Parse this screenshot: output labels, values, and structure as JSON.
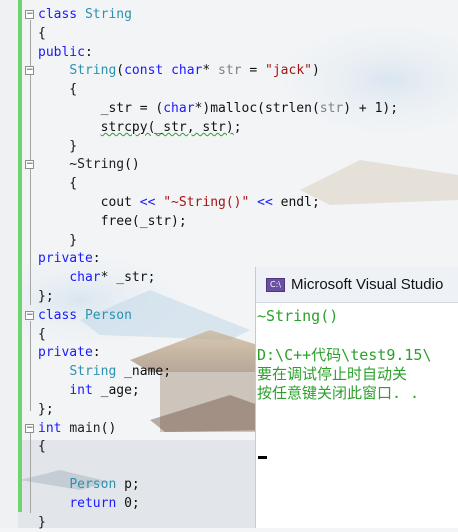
{
  "editor": {
    "lines": [
      {
        "fold": "minus",
        "segments": [
          {
            "c": "kw",
            "t": "class "
          },
          {
            "c": "ty",
            "t": "String"
          }
        ]
      },
      {
        "segments": [
          {
            "c": "",
            "t": "{"
          }
        ]
      },
      {
        "segments": [
          {
            "c": "kw",
            "t": "public"
          },
          {
            "c": "",
            "t": ":"
          }
        ]
      },
      {
        "fold": "minus",
        "segments": [
          {
            "c": "",
            "t": "    "
          },
          {
            "c": "ty",
            "t": "String"
          },
          {
            "c": "",
            "t": "("
          },
          {
            "c": "kw",
            "t": "const "
          },
          {
            "c": "kw",
            "t": "char"
          },
          {
            "c": "",
            "t": "* "
          },
          {
            "c": "var",
            "t": "str"
          },
          {
            "c": "",
            "t": " = "
          },
          {
            "c": "str",
            "t": "\"jack\""
          },
          {
            "c": "",
            "t": ")"
          }
        ]
      },
      {
        "segments": [
          {
            "c": "",
            "t": "    {"
          }
        ]
      },
      {
        "segments": [
          {
            "c": "",
            "t": "        _str = ("
          },
          {
            "c": "kw",
            "t": "char"
          },
          {
            "c": "",
            "t": "*)malloc(strlen("
          },
          {
            "c": "var",
            "t": "str"
          },
          {
            "c": "",
            "t": ") + 1);"
          }
        ]
      },
      {
        "segments": [
          {
            "c": "",
            "t": "        "
          },
          {
            "c": "sq",
            "t": "strcpy(_str, str)"
          },
          {
            "c": "",
            "t": ";"
          }
        ]
      },
      {
        "segments": [
          {
            "c": "",
            "t": "    }"
          }
        ]
      },
      {
        "fold": "minus",
        "segments": [
          {
            "c": "",
            "t": "    ~"
          },
          {
            "c": "fn",
            "t": "String"
          },
          {
            "c": "",
            "t": "()"
          }
        ]
      },
      {
        "segments": [
          {
            "c": "",
            "t": "    {"
          }
        ]
      },
      {
        "segments": [
          {
            "c": "",
            "t": "        cout "
          },
          {
            "c": "kw",
            "t": "<<"
          },
          {
            "c": "",
            "t": " "
          },
          {
            "c": "str",
            "t": "\"~String()\""
          },
          {
            "c": "",
            "t": " "
          },
          {
            "c": "kw",
            "t": "<<"
          },
          {
            "c": "",
            "t": " endl;"
          }
        ]
      },
      {
        "segments": [
          {
            "c": "",
            "t": "        free(_str);"
          }
        ]
      },
      {
        "segments": [
          {
            "c": "",
            "t": "    }"
          }
        ]
      },
      {
        "segments": [
          {
            "c": "kw",
            "t": "private"
          },
          {
            "c": "",
            "t": ":"
          }
        ]
      },
      {
        "segments": [
          {
            "c": "",
            "t": "    "
          },
          {
            "c": "kw",
            "t": "char"
          },
          {
            "c": "",
            "t": "* _str;"
          }
        ]
      },
      {
        "segments": [
          {
            "c": "",
            "t": "};"
          }
        ]
      },
      {
        "fold": "minus",
        "segments": [
          {
            "c": "kw",
            "t": "class "
          },
          {
            "c": "ty",
            "t": "Person"
          }
        ]
      },
      {
        "segments": [
          {
            "c": "",
            "t": "{"
          }
        ]
      },
      {
        "segments": [
          {
            "c": "kw",
            "t": "private"
          },
          {
            "c": "",
            "t": ":"
          }
        ]
      },
      {
        "segments": [
          {
            "c": "",
            "t": "    "
          },
          {
            "c": "ty",
            "t": "String"
          },
          {
            "c": "",
            "t": " _name;"
          }
        ]
      },
      {
        "segments": [
          {
            "c": "",
            "t": "    "
          },
          {
            "c": "kw",
            "t": "int"
          },
          {
            "c": "",
            "t": " _age;"
          }
        ]
      },
      {
        "segments": [
          {
            "c": "",
            "t": "};"
          }
        ]
      },
      {
        "fold": "minus",
        "segments": [
          {
            "c": "kw",
            "t": "int "
          },
          {
            "c": "fn",
            "t": "main"
          },
          {
            "c": "",
            "t": "()"
          }
        ]
      },
      {
        "segments": [
          {
            "c": "",
            "t": "{"
          }
        ]
      },
      {
        "segments": [
          {
            "c": "",
            "t": ""
          }
        ]
      },
      {
        "segments": [
          {
            "c": "",
            "t": "    "
          },
          {
            "c": "ty",
            "t": "Person"
          },
          {
            "c": "",
            "t": " p;"
          }
        ]
      },
      {
        "segments": [
          {
            "c": "",
            "t": "    "
          },
          {
            "c": "kw",
            "t": "return"
          },
          {
            "c": "",
            "t": " 0;"
          }
        ]
      },
      {
        "segments": [
          {
            "c": "",
            "t": "}"
          }
        ]
      }
    ]
  },
  "console": {
    "icon_label": "C:\\",
    "title": "Microsoft Visual Studio",
    "output_lines": [
      "~String()",
      "",
      "D:\\C++代码\\test9.15\\",
      "要在调试停止时自动关",
      "按任意键关闭此窗口. ."
    ]
  },
  "colors": {
    "keyword": "#1a1aff",
    "type": "#2b91af",
    "string": "#a31515",
    "console_text": "#2ba02b",
    "change_bar": "#6fd36f"
  }
}
